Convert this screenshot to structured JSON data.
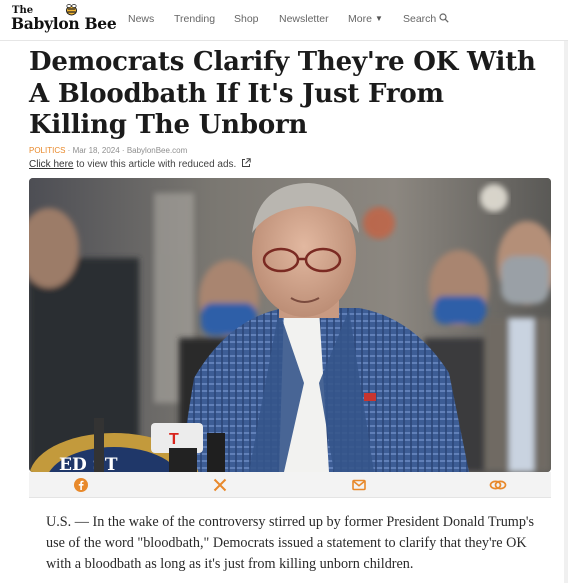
{
  "site": {
    "logo_the": "The",
    "logo_name": "Babylon Bee"
  },
  "nav": {
    "items": [
      {
        "label": "News"
      },
      {
        "label": "Trending"
      },
      {
        "label": "Shop"
      },
      {
        "label": "Newsletter"
      },
      {
        "label": "More",
        "icon": "caret-down-icon"
      },
      {
        "label": "Search",
        "icon": "search-icon"
      }
    ]
  },
  "article": {
    "headline": "Democrats Clarify They're OK With A Bloodbath If It's Just From Killing The Unborn",
    "category": "POLITICS",
    "meta_rest": " · Mar 18, 2024 · BabylonBee.com",
    "reduced_ads_link": "Click here",
    "reduced_ads_rest": " to view this article with reduced ads.",
    "hero_alt": "",
    "hero_plaque_text": "ED ST",
    "share": [
      {
        "network": "facebook",
        "icon": "facebook-icon",
        "color": "#e8892b"
      },
      {
        "network": "x",
        "icon": "x-icon",
        "color": "#e8892b"
      },
      {
        "network": "email",
        "icon": "email-icon",
        "color": "#e8892b"
      },
      {
        "network": "copy-link",
        "icon": "link-icon",
        "color": "#e8892b"
      }
    ],
    "body": "U.S. — In the wake of the controversy stirred up by former President Donald Trump's use of the word \"bloodbath,\" Democrats issued a statement to clarify that they're OK with a bloodbath as long as it's just from killing unborn children."
  },
  "colors": {
    "accent": "#e8892b",
    "headline": "#1b1b1b"
  }
}
